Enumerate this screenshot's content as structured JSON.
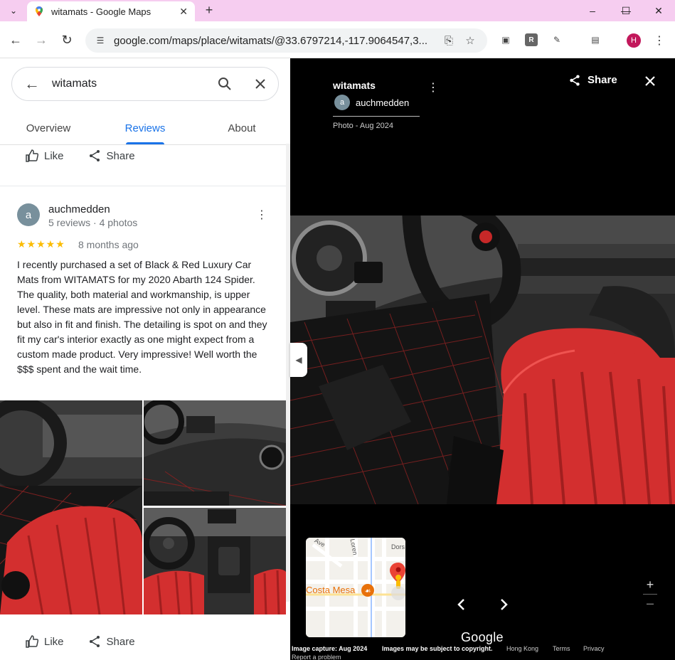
{
  "browser": {
    "tab_title": "witamats - Google Maps",
    "url": "google.com/maps/place/witamats/@33.6797214,-117.9064547,3...",
    "profile_initial": "H",
    "accent": "#f6cdf0"
  },
  "panel": {
    "search_query": "witamats",
    "tabs": [
      "Overview",
      "Reviews",
      "About"
    ],
    "active_tab": "Reviews",
    "like_label": "Like",
    "share_label": "Share"
  },
  "review": {
    "avatar_initial": "a",
    "name": "auchmedden",
    "meta": "5 reviews · 4 photos",
    "stars": "★★★★★",
    "rating": 5,
    "time_ago": "8 months ago",
    "text": "I recently purchased a set of Black & Red Luxury Car Mats from WITAMATS for my 2020 Abarth 124 Spider. The quality, both material and workmanship, is upper level. These mats are impressive not only in appearance but also in fit and finish. The detailing is spot on and they fit my car's interior exactly as one might expect from a custom made product. Very impressive! Well worth the $$$ spent and the wait time."
  },
  "viewer": {
    "title": "witamats",
    "author_initial": "a",
    "author": "auchmedden",
    "date": "Photo - Aug 2024",
    "share_label": "Share",
    "map_label": "Costa Mesa",
    "map_streets": [
      "Ave",
      "Loren",
      "Dors"
    ],
    "google_label": "Google",
    "footer": {
      "capture": "Image capture: Aug 2024",
      "copyright": "Images may be subject to copyright.",
      "region": "Hong Kong",
      "terms": "Terms",
      "privacy": "Privacy",
      "report": "Report a problem"
    }
  }
}
